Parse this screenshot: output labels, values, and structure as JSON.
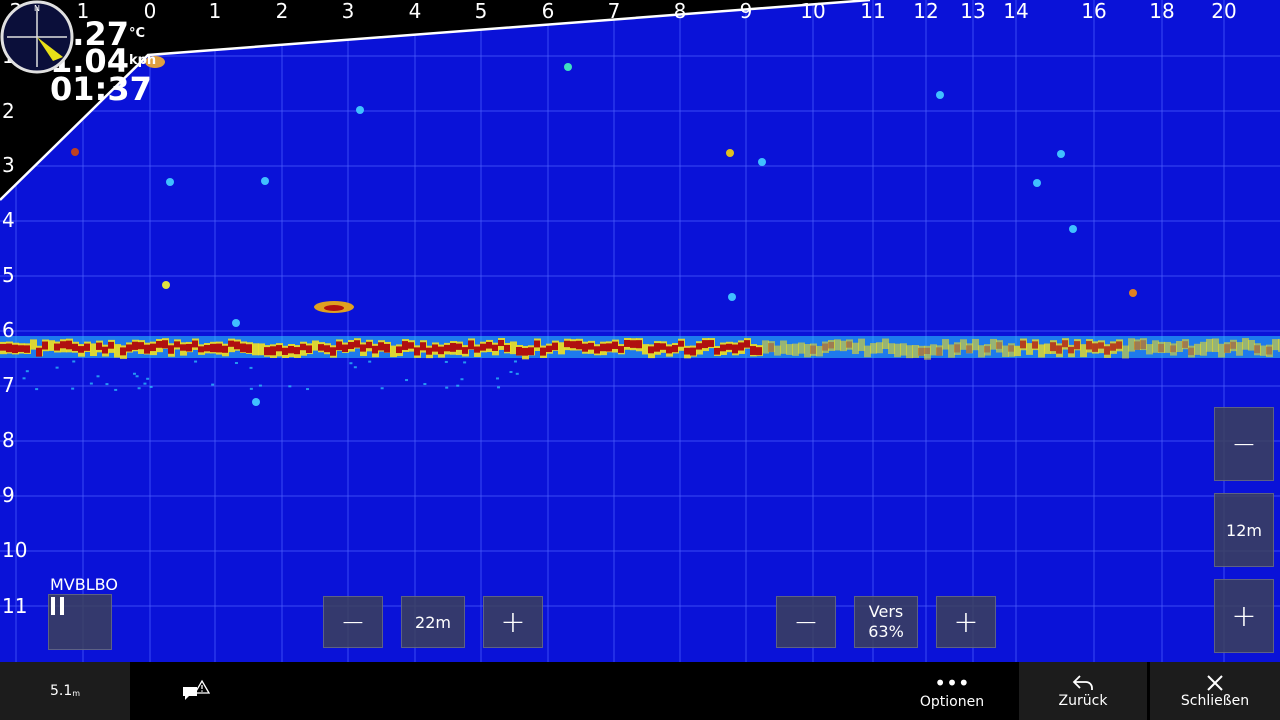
{
  "x_scale": [
    "2",
    "1",
    "0",
    "1",
    "2",
    "3",
    "4",
    "5",
    "6",
    "7",
    "8",
    "9",
    "10",
    "11",
    "12",
    "13",
    "14",
    "16",
    "18",
    "20"
  ],
  "y_scale": [
    "1",
    "2",
    "3",
    "4",
    "5",
    "6",
    "7",
    "8",
    "9",
    "10",
    "11"
  ],
  "readouts": {
    "temperature": "8.27",
    "temperature_unit": "°C",
    "speed": "1.04",
    "speed_unit": "kph",
    "time": "01:37"
  },
  "mode_label": "MVBLBO",
  "pause_icon": "pause-icon",
  "range_control": {
    "minus": "−",
    "value": "22m",
    "plus": "+"
  },
  "gain_control": {
    "minus": "−",
    "label": "Vers",
    "value": "63%",
    "plus": "+"
  },
  "zoom_control": {
    "minus": "−",
    "value": "12m",
    "plus": "+"
  },
  "bottom_bar": {
    "depth_value": "5.1",
    "depth_unit": "m",
    "alert_icon": "message-alert-icon",
    "options_label": "Optionen",
    "back_label": "Zurück",
    "close_label": "Schließen"
  },
  "compass_north": "N",
  "colors": {
    "water": "#0a12d8",
    "grid": "#4f63ff",
    "bottom_strong": "#b01010",
    "bottom_mid": "#f0e020",
    "bottom_weak": "#30d0ff"
  }
}
